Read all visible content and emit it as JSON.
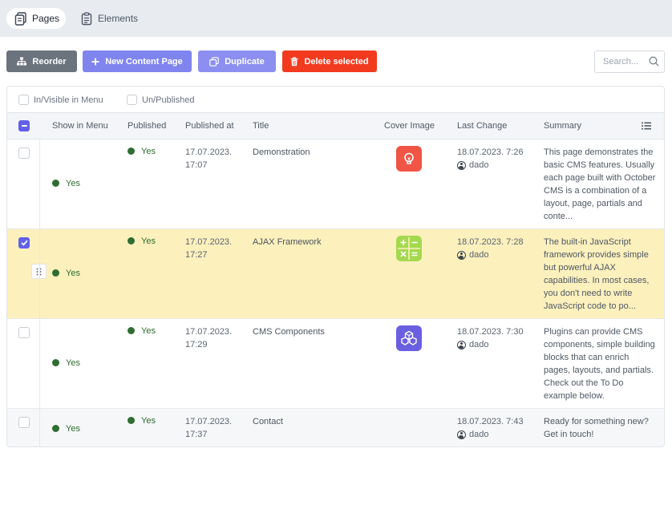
{
  "tabs": [
    {
      "label": "Pages",
      "icon": "pages-icon",
      "active": true
    },
    {
      "label": "Elements",
      "icon": "elements-icon",
      "active": false
    }
  ],
  "toolbar": {
    "reorder_label": "Reorder",
    "new_label": "New Content Page",
    "duplicate_label": "Duplicate",
    "delete_label": "Delete selected",
    "search_placeholder": "Search..."
  },
  "filters": {
    "menu_label": "In/Visible in Menu",
    "published_label": "Un/Published"
  },
  "columns": {
    "show_in_menu": "Show in Menu",
    "published": "Published",
    "published_at": "Published at",
    "title": "Title",
    "cover_image": "Cover Image",
    "last_change": "Last Change",
    "summary": "Summary"
  },
  "colors": {
    "accent": "#6260e8",
    "status_green": "#2f6d32",
    "delete_red": "#f23a1f",
    "selected_row": "#fcf0bd"
  },
  "rows": [
    {
      "checked": false,
      "show_in_menu": "Yes",
      "published": "Yes",
      "published_at_date": "17.07.2023.",
      "published_at_time": "17:07",
      "title": "Demonstration",
      "cover": {
        "icon": "lightbulb-icon",
        "color": "#f05545"
      },
      "last_change": "18.07.2023. 7:26",
      "user": "dado",
      "summary": "This page demonstrates the basic CMS features. Usually each page built with October CMS is a combination of a layout, page, partials and conte..."
    },
    {
      "checked": true,
      "show_in_menu": "Yes",
      "published": "Yes",
      "published_at_date": "17.07.2023.",
      "published_at_time": "17:27",
      "title": "AJAX Framework",
      "cover": {
        "icon": "calculator-icon",
        "color": "#a4d94e"
      },
      "last_change": "18.07.2023. 7:28",
      "user": "dado",
      "summary": "The built-in JavaScript framework provides simple but powerful AJAX capabilities. In most cases, you don't need to write JavaScript code to po..."
    },
    {
      "checked": false,
      "show_in_menu": "Yes",
      "published": "Yes",
      "published_at_date": "17.07.2023.",
      "published_at_time": "17:29",
      "title": "CMS Components",
      "cover": {
        "icon": "cubes-icon",
        "color": "#6a5fe0"
      },
      "last_change": "18.07.2023. 7:30",
      "user": "dado",
      "summary": "Plugins can provide CMS components, simple building blocks that can enrich pages, layouts, and partials. Check out the To Do example below."
    },
    {
      "checked": false,
      "show_in_menu": "Yes",
      "published": "Yes",
      "published_at_date": "17.07.2023.",
      "published_at_time": "17:37",
      "title": "Contact",
      "cover": null,
      "last_change": "18.07.2023. 7:43",
      "user": "dado",
      "summary": "Ready for something new? Get in touch!"
    }
  ]
}
